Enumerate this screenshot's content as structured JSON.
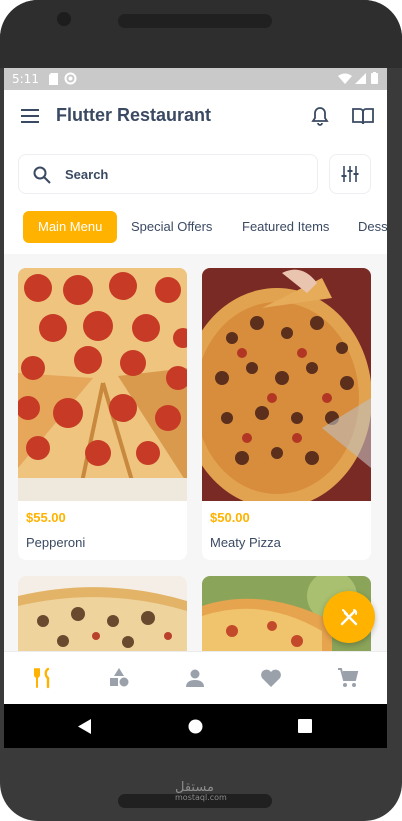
{
  "status_bar": {
    "time": "5:11"
  },
  "app_bar": {
    "title": "Flutter Restaurant",
    "menu_icon": "hamburger-menu-icon",
    "notification_icon": "bell-icon",
    "orders_icon": "book-open-icon"
  },
  "search": {
    "placeholder": "Search",
    "icon": "search-icon",
    "filter_icon": "sliders-icon"
  },
  "tabs": [
    {
      "label": "Main Menu",
      "active": true
    },
    {
      "label": "Special Offers",
      "active": false
    },
    {
      "label": "Featured Items",
      "active": false
    },
    {
      "label": "Dess",
      "active": false
    }
  ],
  "products": [
    {
      "name": "Pepperoni",
      "price": "$55.00"
    },
    {
      "name": "Meaty Pizza",
      "price": "$50.00"
    },
    {
      "name": "",
      "price": ""
    },
    {
      "name": "",
      "price": ""
    }
  ],
  "fab": {
    "icon": "fork-knife-icon"
  },
  "bottom_nav": [
    {
      "id": "menu",
      "icon": "utensils-icon",
      "active": true
    },
    {
      "id": "categories",
      "icon": "shapes-icon",
      "active": false
    },
    {
      "id": "profile",
      "icon": "person-icon",
      "active": false
    },
    {
      "id": "favorites",
      "icon": "heart-icon",
      "active": false
    },
    {
      "id": "cart",
      "icon": "cart-icon",
      "active": false
    }
  ],
  "colors": {
    "accent": "#ffb300",
    "text": "#3b4a63",
    "icon_grey": "#9aa1ab"
  },
  "watermark": {
    "text": "مستقل",
    "sub": "mostaql.com"
  }
}
